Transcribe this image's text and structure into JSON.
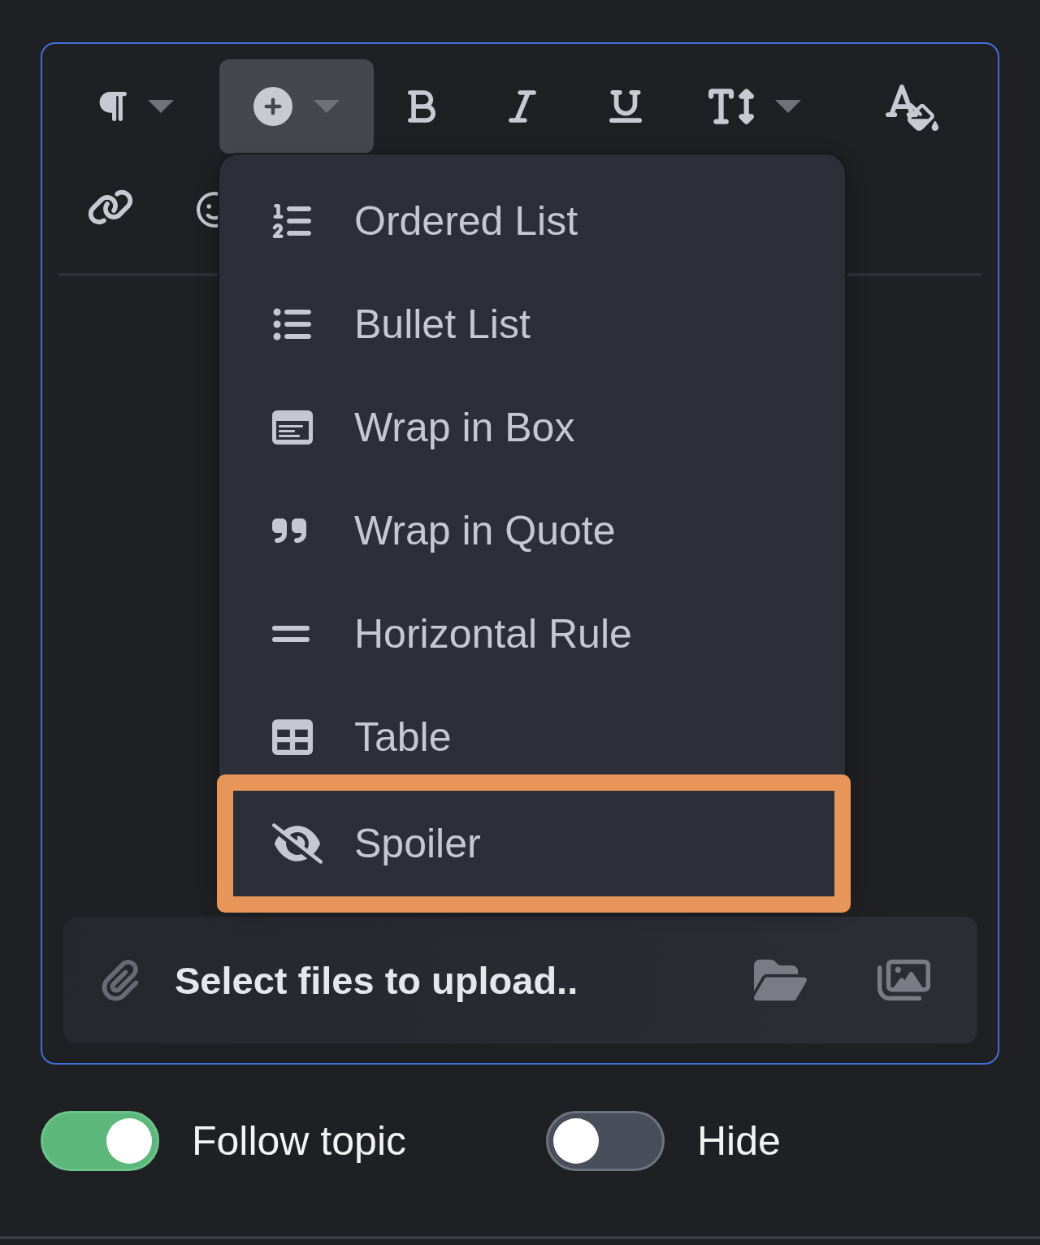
{
  "editor": {
    "toolbar": {
      "row_1": [
        {
          "kind": "paragraph",
          "dropdown": true,
          "selected": false
        },
        {
          "kind": "insert",
          "dropdown": true,
          "selected": true
        },
        {
          "kind": "bold",
          "dropdown": false,
          "selected": false
        },
        {
          "kind": "italic",
          "dropdown": false,
          "selected": false
        },
        {
          "kind": "underline",
          "dropdown": false,
          "selected": false
        },
        {
          "kind": "text_size",
          "dropdown": true,
          "selected": false
        },
        {
          "kind": "text_color",
          "dropdown": false,
          "selected": false
        }
      ],
      "row_2": [
        {
          "kind": "link",
          "selected": false
        },
        {
          "kind": "emoji",
          "selected": false
        }
      ]
    },
    "insert_menu": {
      "items": [
        {
          "kind": "ordered_list",
          "label": "Ordered List",
          "selected": false
        },
        {
          "kind": "bullet_list",
          "label": "Bullet List",
          "selected": false
        },
        {
          "kind": "box",
          "label": "Wrap in Box",
          "selected": false
        },
        {
          "kind": "quote",
          "label": "Wrap in Quote",
          "selected": false
        },
        {
          "kind": "horizontal_rule",
          "label": "Horizontal Rule",
          "selected": false
        },
        {
          "kind": "table",
          "label": "Table",
          "selected": false
        },
        {
          "kind": "spoiler",
          "label": "Spoiler",
          "selected": true
        }
      ]
    },
    "upload_bar": {
      "label": "Select files to upload.."
    }
  },
  "toggles": [
    {
      "label": "Follow topic",
      "on": true
    },
    {
      "label": "Hide",
      "on": false
    }
  ]
}
